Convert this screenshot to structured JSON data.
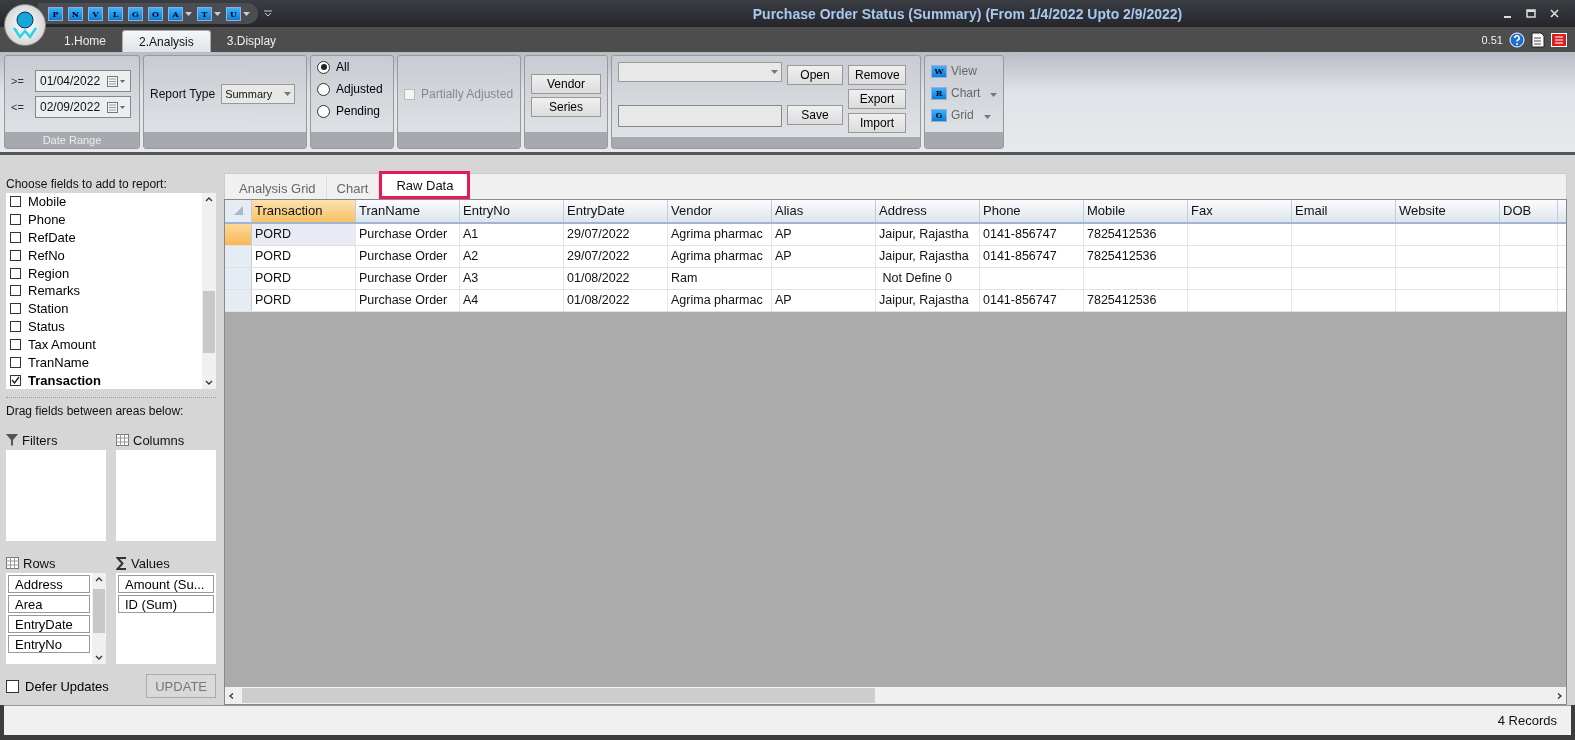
{
  "title_bar": {
    "title": "Purchase Order Status (Summary)  (From 1/4/2022 Upto 2/9/2022)",
    "quick_access": [
      {
        "letter": "P",
        "dropdown": false
      },
      {
        "letter": "N",
        "dropdown": false
      },
      {
        "letter": "V",
        "dropdown": false
      },
      {
        "letter": "L",
        "dropdown": false
      },
      {
        "letter": "G",
        "dropdown": false
      },
      {
        "letter": "O",
        "dropdown": false
      },
      {
        "letter": "A",
        "dropdown": true
      },
      {
        "letter": "T",
        "dropdown": true
      },
      {
        "letter": "U",
        "dropdown": true
      }
    ]
  },
  "ribbon_tabs": [
    {
      "label": "1.Home",
      "selected": false
    },
    {
      "label": "2.Analysis",
      "selected": true
    },
    {
      "label": "3.Display",
      "selected": false
    }
  ],
  "version": "0.51",
  "date_range": {
    "caption": "Date Range",
    "fields": [
      {
        "operator": ">=",
        "value": "01/04/2022"
      },
      {
        "operator": "<=",
        "value": "02/09/2022"
      }
    ]
  },
  "report_type": {
    "label": "Report Type",
    "value": "Summary"
  },
  "status_filter": [
    {
      "label": "All",
      "selected": true
    },
    {
      "label": "Adjusted",
      "selected": false
    },
    {
      "label": "Pending",
      "selected": false
    }
  ],
  "partially_adjusted": {
    "label": "Partially Adjusted",
    "checked": false,
    "disabled": true
  },
  "group_buttons": [
    "Vendor",
    "Series"
  ],
  "layout": {
    "open": "Open",
    "remove": "Remove",
    "export": "Export",
    "save": "Save",
    "import": "Import"
  },
  "view_menu": [
    {
      "letter": "W",
      "label": "View",
      "dropdown": false
    },
    {
      "letter": "R",
      "label": "Chart",
      "dropdown": true
    },
    {
      "letter": "G",
      "label": "Grid",
      "dropdown": true
    }
  ],
  "field_list": {
    "caption": "Choose fields to add to report:",
    "items": [
      {
        "label": "Mobile",
        "checked": false
      },
      {
        "label": "Phone",
        "checked": false
      },
      {
        "label": "RefDate",
        "checked": false
      },
      {
        "label": "RefNo",
        "checked": false
      },
      {
        "label": "Region",
        "checked": false
      },
      {
        "label": "Remarks",
        "checked": false
      },
      {
        "label": "Station",
        "checked": false
      },
      {
        "label": "Status",
        "checked": false
      },
      {
        "label": "Tax Amount",
        "checked": false
      },
      {
        "label": "TranName",
        "checked": false
      },
      {
        "label": "Transaction",
        "checked": true
      }
    ]
  },
  "drag_caption": "Drag fields between areas below:",
  "areas": [
    {
      "kind": "filters",
      "label": "Filters"
    },
    {
      "kind": "columns",
      "label": "Columns"
    },
    {
      "kind": "rows",
      "label": "Rows",
      "items": [
        "Address",
        "Area",
        "EntryDate",
        "EntryNo"
      ]
    },
    {
      "kind": "values",
      "label": "Values",
      "items": [
        "Amount (Su...",
        "ID (Sum)"
      ]
    }
  ],
  "defer_updates": {
    "label": "Defer Updates",
    "checked": false
  },
  "update_button": {
    "label": "UPDATE",
    "disabled": true
  },
  "view_tabs": [
    {
      "label": "Analysis Grid",
      "selected": false
    },
    {
      "label": "Chart",
      "selected": false
    },
    {
      "label": "Raw Data",
      "selected": true
    }
  ],
  "table": {
    "columns": [
      {
        "label": "Transaction",
        "selected": true
      },
      {
        "label": "TranName",
        "selected": false
      },
      {
        "label": "EntryNo",
        "selected": false
      },
      {
        "label": "EntryDate",
        "selected": false
      },
      {
        "label": "Vendor",
        "selected": false
      },
      {
        "label": "Alias",
        "selected": false
      },
      {
        "label": "Address",
        "selected": false
      },
      {
        "label": "Phone",
        "selected": false
      },
      {
        "label": "Mobile",
        "selected": false
      },
      {
        "label": "Fax",
        "selected": false
      },
      {
        "label": "Email",
        "selected": false
      },
      {
        "label": "Website",
        "selected": false
      },
      {
        "label": "DOB",
        "selected": false
      }
    ],
    "rows": [
      {
        "selected": true,
        "cells": [
          "PORD",
          "Purchase Order",
          "A1",
          "29/07/2022",
          "Agrima pharmac",
          "AP",
          "Jaipur, Rajastha",
          "0141-856747",
          "7825412536",
          "",
          "",
          "",
          ""
        ]
      },
      {
        "selected": false,
        "cells": [
          "PORD",
          "Purchase Order",
          "A2",
          "29/07/2022",
          "Agrima pharmac",
          "AP",
          "Jaipur, Rajastha",
          "0141-856747",
          "7825412536",
          "",
          "",
          "",
          ""
        ]
      },
      {
        "selected": false,
        "cells": [
          "PORD",
          "Purchase Order",
          "A3",
          "01/08/2022",
          "Ram",
          "",
          " Not Define 0",
          "",
          "",
          "",
          "",
          "",
          ""
        ]
      },
      {
        "selected": false,
        "cells": [
          "PORD",
          "Purchase Order",
          "A4",
          "01/08/2022",
          "Agrima pharmac",
          "AP",
          "Jaipur, Rajastha",
          "0141-856747",
          "7825412536",
          "",
          "",
          "",
          ""
        ]
      }
    ]
  },
  "status_bar": {
    "records": "4 Records"
  }
}
